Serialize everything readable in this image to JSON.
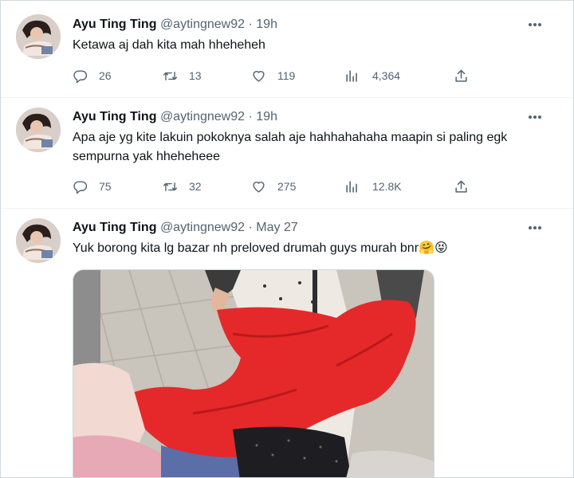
{
  "tweets": [
    {
      "name": "Ayu Ting Ting",
      "handle": "@aytingnew92",
      "sep": "·",
      "time": "19h",
      "text": "Ketawa aj dah kita mah hheheheh",
      "replies": "26",
      "retweets": "13",
      "likes": "119",
      "views": "4,364"
    },
    {
      "name": "Ayu Ting Ting",
      "handle": "@aytingnew92",
      "sep": "·",
      "time": "19h",
      "text": "Apa aje yg kite lakuin pokoknya salah aje hahhahahaha maapin si paling egk sempurna yak hheheheee",
      "replies": "75",
      "retweets": "32",
      "likes": "275",
      "views": "12.8K"
    },
    {
      "name": "Ayu Ting Ting",
      "handle": "@aytingnew92",
      "sep": "·",
      "time": "May 27",
      "text": "Yuk borong kita lg bazar nh preloved drumah guys murah bnr",
      "emojis": "🤗😝"
    }
  ],
  "icons": {
    "more": "more-horizontal-icon",
    "reply": "reply-icon",
    "retweet": "retweet-icon",
    "like": "heart-icon",
    "views": "views-icon",
    "share": "share-icon"
  },
  "colors": {
    "text": "#0f1419",
    "secondary": "#536471",
    "border": "#eff3f4"
  }
}
